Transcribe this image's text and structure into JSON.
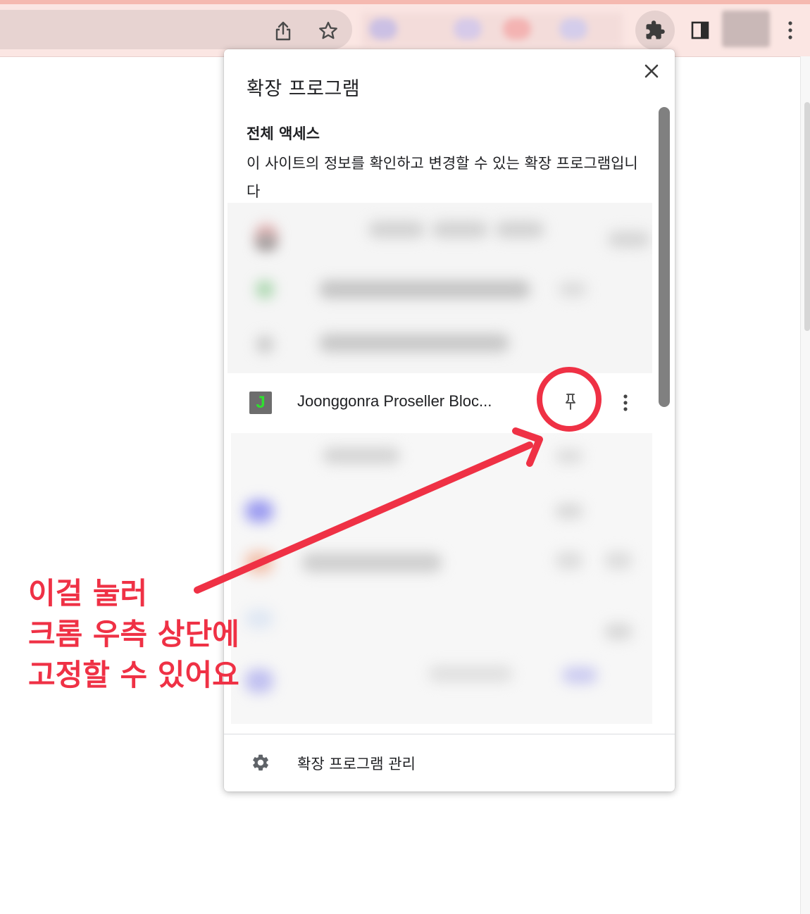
{
  "browser": {
    "toolbar_color": "#fbe6e3",
    "icons": [
      "share-icon",
      "bookmark-star-icon",
      "extensions-puzzle-icon",
      "side-panel-icon",
      "kebab-menu-icon"
    ]
  },
  "popup": {
    "title": "확장 프로그램",
    "section": {
      "heading": "전체 액세스",
      "description": "이 사이트의 정보를 확인하고 변경할 수 있는 확장 프로그램입니다"
    },
    "visible_extension": {
      "icon_letter": "J",
      "icon_letter_color": "#2fe02f",
      "name": "Joonggonra Proseller Bloc..."
    },
    "footer": {
      "manage_label": "확장 프로그램 관리"
    }
  },
  "annotation": {
    "color": "#ef3145",
    "lines": [
      "이걸 눌러",
      "크롬 우측 상단에",
      "고정할 수 있어요"
    ]
  }
}
